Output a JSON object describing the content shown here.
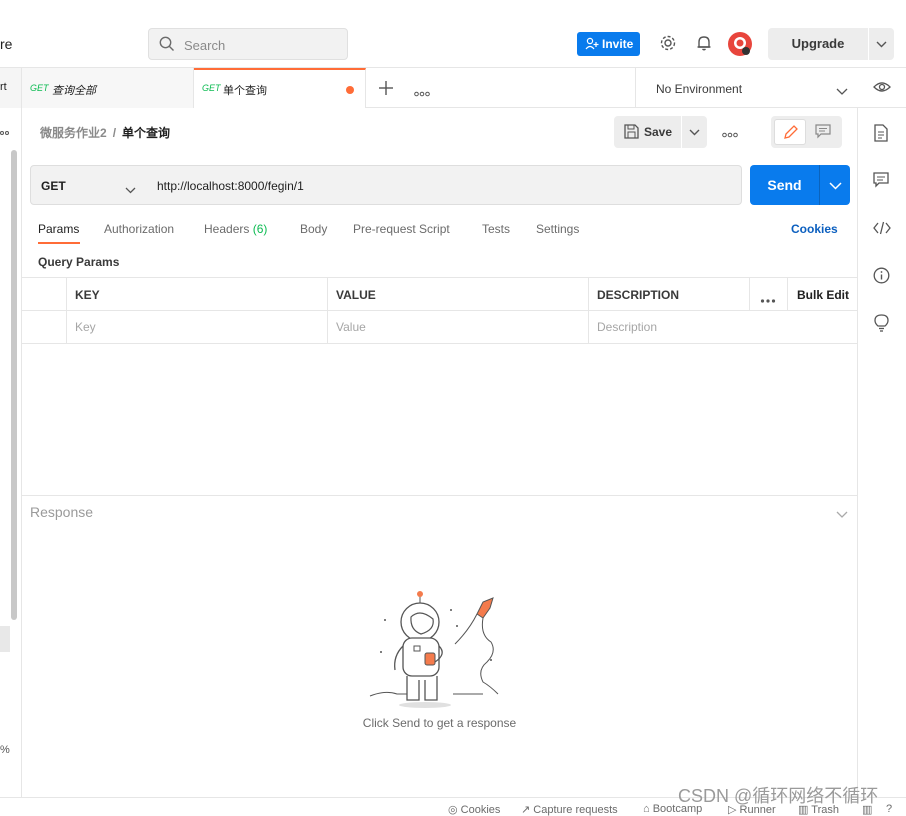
{
  "header": {
    "brand_fragment": "re",
    "search_placeholder": "Search",
    "invite_label": "Invite",
    "upgrade_label": "Upgrade"
  },
  "tabs": [
    {
      "method": "GET",
      "name": "查询全部"
    },
    {
      "method": "GET",
      "name": "单个查询",
      "unsaved": true
    }
  ],
  "tab_edge_fragment": "rt",
  "environment": {
    "selected": "No Environment"
  },
  "breadcrumb": {
    "parent": "微服务作业2",
    "separator": "/",
    "current": "单个查询"
  },
  "toolbar": {
    "save_label": "Save"
  },
  "request": {
    "method": "GET",
    "url": "http://localhost:8000/fegin/1",
    "send_label": "Send"
  },
  "request_tabs": {
    "params": "Params",
    "authorization": "Authorization",
    "headers": "Headers",
    "headers_count": "(6)",
    "body": "Body",
    "pre_request": "Pre-request Script",
    "tests": "Tests",
    "settings": "Settings",
    "cookies": "Cookies"
  },
  "query_params": {
    "title": "Query Params",
    "headers": {
      "key": "KEY",
      "value": "VALUE",
      "description": "DESCRIPTION",
      "bulk_edit": "Bulk Edit"
    },
    "placeholders": {
      "key": "Key",
      "value": "Value",
      "description": "Description"
    }
  },
  "response": {
    "title": "Response",
    "empty_message": "Click Send to get a response"
  },
  "left_rail": {
    "percent_fragment": "%"
  },
  "status_bar": {
    "cookies": "Cookies",
    "capture": "Capture requests",
    "bootcamp": "Bootcamp",
    "runner": "Runner",
    "trash": "Trash"
  },
  "watermark": "CSDN @循环网络不循环",
  "colors": {
    "accent": "#ff6c37",
    "primary": "#097bed",
    "get": "#0cbb52",
    "link": "#0b5fbf"
  }
}
